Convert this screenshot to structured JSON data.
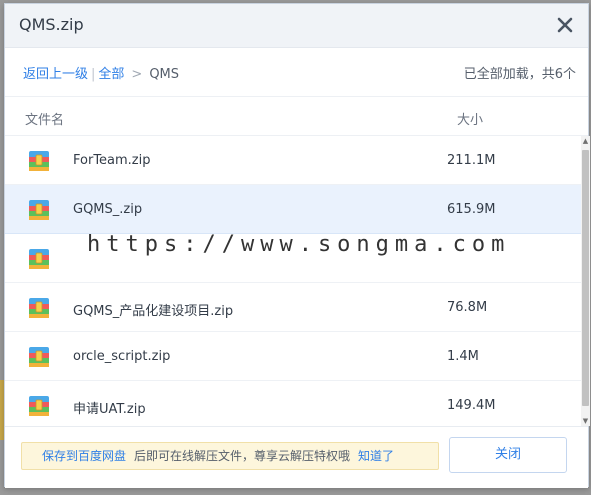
{
  "dialog": {
    "title": "QMS.zip",
    "close_icon": "close-icon"
  },
  "pathbar": {
    "back_label": "返回上一级",
    "separator": "|",
    "all_label": "全部",
    "arrow": ">",
    "current": "QMS",
    "status": "已全部加载，共6个"
  },
  "columns": {
    "name": "文件名",
    "size": "大小"
  },
  "files": [
    {
      "name": "ForTeam.zip",
      "size": "211.1M",
      "icon": "zip-archive-icon",
      "selected": false
    },
    {
      "name": "GQMS_.zip",
      "size": "615.9M",
      "icon": "zip-archive-icon",
      "selected": true
    },
    {
      "name": "",
      "size": "",
      "icon": "zip-archive-icon",
      "selected": false
    },
    {
      "name": "GQMS_产品化建设项目.zip",
      "size": "76.8M",
      "icon": "zip-archive-icon",
      "selected": false
    },
    {
      "name": "orcle_script.zip",
      "size": "1.4M",
      "icon": "zip-archive-icon",
      "selected": false
    },
    {
      "name": "申请UAT.zip",
      "size": "149.4M",
      "icon": "zip-archive-icon",
      "selected": false
    }
  ],
  "watermark": "https://www.songma.com",
  "footer": {
    "save_link": "保存到百度网盘",
    "promo_text": "后即可在线解压文件，尊享云解压特权哦",
    "got_it": "知道了",
    "close_button": "关闭"
  },
  "colors": {
    "link": "#2f7fe6",
    "selected_row": "#eaf2fd",
    "promo_bg": "#fdf6dc"
  }
}
